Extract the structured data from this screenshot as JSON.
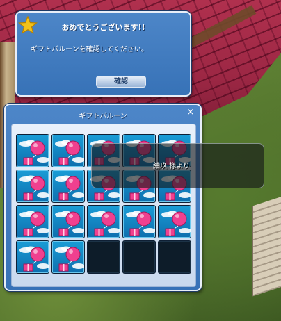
{
  "notification": {
    "title": "おめでとうございます!!",
    "message": "ギフトバルーンを確認してください。",
    "confirm_label": "確認"
  },
  "gift_window": {
    "title": "ギフトバルーン",
    "close_label": "×",
    "slots": [
      {
        "item": "gift-balloon-icon"
      },
      {
        "item": "gift-balloon-icon"
      },
      {
        "item": "gift-balloon-icon"
      },
      {
        "item": "gift-balloon-icon"
      },
      {
        "item": "gift-balloon-icon"
      },
      {
        "item": "gift-balloon-icon"
      },
      {
        "item": "gift-balloon-icon"
      },
      {
        "item": "gift-balloon-icon"
      },
      {
        "item": "gift-balloon-icon"
      },
      {
        "item": "gift-balloon-icon"
      },
      {
        "item": "gift-balloon-icon"
      },
      {
        "item": "gift-balloon-icon"
      },
      {
        "item": "gift-balloon-icon"
      },
      {
        "item": "gift-balloon-icon"
      },
      {
        "item": "gift-balloon-icon"
      },
      {
        "item": "gift-balloon-icon"
      },
      {
        "item": "gift-balloon-icon"
      },
      {
        "item": null
      },
      {
        "item": null
      },
      {
        "item": null
      }
    ]
  },
  "tooltip": {
    "sender": "紬玖 様より"
  },
  "colors": {
    "window_blue": "#3772b7",
    "slot_blue": "#1a9dd6",
    "balloon_pink": "#f0408f",
    "star_yellow": "#f2c21b"
  }
}
